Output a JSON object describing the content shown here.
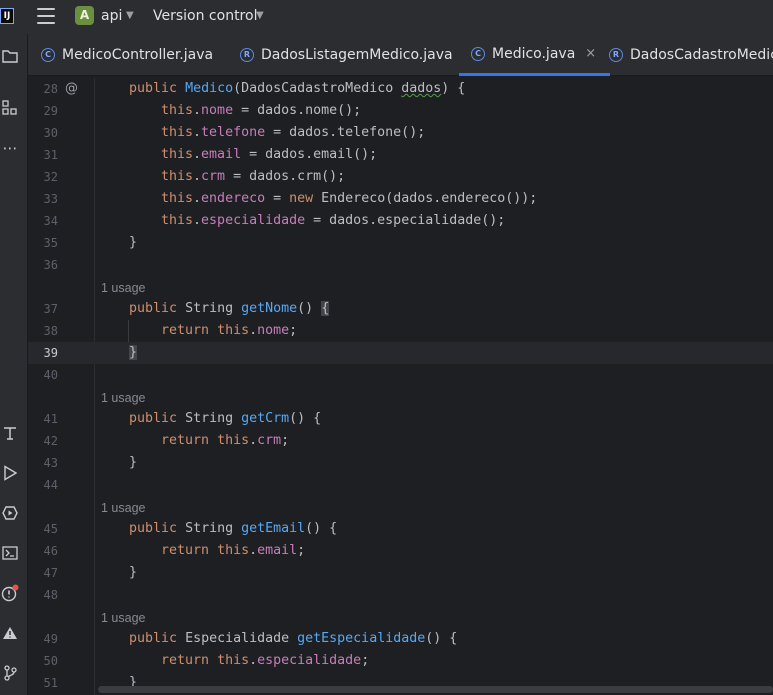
{
  "titlebar": {
    "logo": "IJ",
    "project_badge": "A",
    "project_name": "api",
    "vcs_label": "Version control"
  },
  "tabs": [
    {
      "label": "MedicoController.java",
      "icon": "C",
      "active": false
    },
    {
      "label": "DadosListagemMedico.java",
      "icon": "R",
      "active": false
    },
    {
      "label": "Medico.java",
      "icon": "C",
      "active": true,
      "close": "×"
    },
    {
      "label": "DadosCadastroMedico.",
      "icon": "R",
      "active": false
    }
  ],
  "toolstrip_icons": [
    "project-icon",
    "structure-icon",
    "more-icon",
    "build-icon",
    "run-icon",
    "services-icon",
    "terminal-icon",
    "problems-icon",
    "warning-icon",
    "git-icon"
  ],
  "editor": {
    "usage_hint": "1 usage",
    "current_line": "39",
    "lines": [
      {
        "n": "28",
        "marker": "@"
      },
      {
        "n": "29"
      },
      {
        "n": "30"
      },
      {
        "n": "31"
      },
      {
        "n": "32"
      },
      {
        "n": "33"
      },
      {
        "n": "34"
      },
      {
        "n": "35"
      },
      {
        "n": "36"
      },
      {
        "n": "37"
      },
      {
        "n": "38"
      },
      {
        "n": "39"
      },
      {
        "n": "40"
      },
      {
        "n": "41"
      },
      {
        "n": "42"
      },
      {
        "n": "43"
      },
      {
        "n": "44"
      },
      {
        "n": "45"
      },
      {
        "n": "46"
      },
      {
        "n": "47"
      },
      {
        "n": "48"
      },
      {
        "n": "49"
      },
      {
        "n": "50"
      },
      {
        "n": "51"
      }
    ],
    "code": {
      "l28_kw": "public",
      "l28_fn": "Medico",
      "l28_rest": "(DadosCadastroMedico ",
      "l28_param": "dados",
      "l28_end": ") {",
      "this": "this",
      "l29_f": "nome",
      "l29_r": " = dados.nome();",
      "l30_f": "telefone",
      "l30_r": " = dados.telefone();",
      "l31_f": "email",
      "l31_r": " = dados.email();",
      "l32_f": "crm",
      "l32_r": " = dados.crm();",
      "l33_f": "endereco",
      "l33_m": " = ",
      "l33_new": "new",
      "l33_r": " Endereco(dados.endereco());",
      "l34_f": "especialidade",
      "l34_r": " = dados.especialidade();",
      "close_brace": "}",
      "open_brace": "{",
      "public": "public",
      "ret": "return",
      "string_t": "String ",
      "l37_fn": "getNome",
      "paren": "() ",
      "semi": ";",
      "dot": ".",
      "l41_fn": "getCrm",
      "l41_end": "() {",
      "l45_fn": "getEmail",
      "l49_type": "Especialidade ",
      "l49_fn": "getEspecialidade",
      "f_nome": "nome",
      "f_crm": "crm",
      "f_email": "email",
      "f_esp": "especialidade"
    }
  },
  "colors": {
    "keyword": "#cf8e6d",
    "method": "#56a8f5",
    "field": "#c77dbb",
    "text": "#bcbec4",
    "background": "#1e1f22",
    "accent": "#3574f0"
  }
}
